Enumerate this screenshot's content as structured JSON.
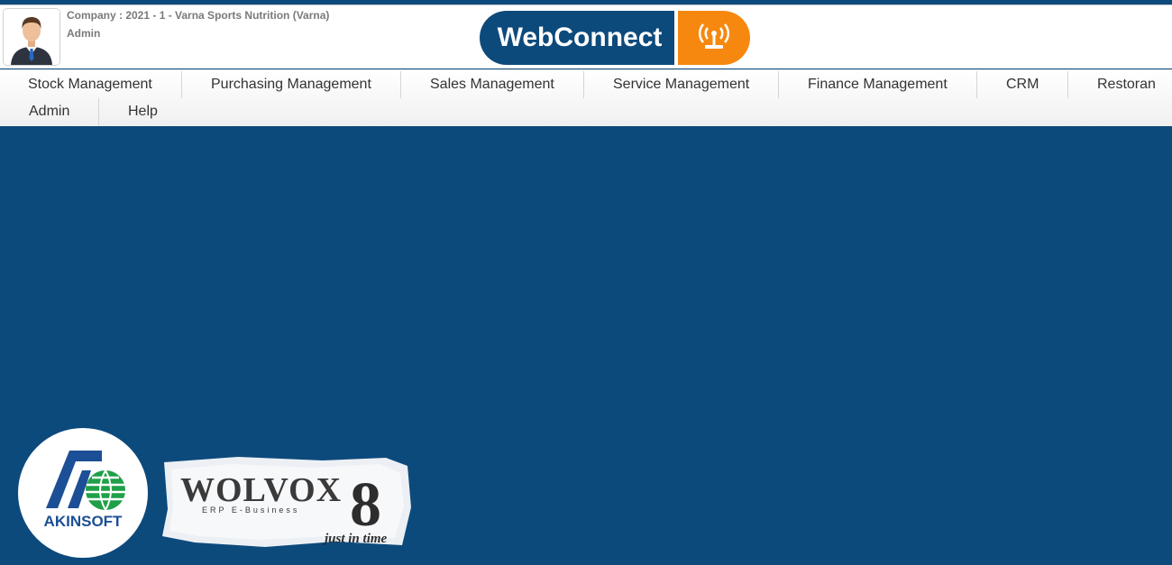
{
  "header": {
    "company_text": "Company : 2021 - 1 - Varna Sports Nutrition (Varna)",
    "user_name": "Admin",
    "avatar_icon": "user-avatar-icon"
  },
  "logo": {
    "text": "WebConnect",
    "icon": "antenna-signal-icon",
    "colors": {
      "blue": "#0d4a7c",
      "orange": "#f7880f"
    }
  },
  "nav": {
    "items": [
      {
        "label": "Stock Management"
      },
      {
        "label": "Purchasing Management"
      },
      {
        "label": "Sales Management"
      },
      {
        "label": "Service Management"
      },
      {
        "label": "Finance Management"
      },
      {
        "label": "CRM"
      },
      {
        "label": "Restoran"
      },
      {
        "label": "Admin"
      },
      {
        "label": "Help"
      }
    ]
  },
  "branding": {
    "akinsoft": "AKINSOFT",
    "wolvox": "WOLVOX",
    "wolvox_version": "8",
    "wolvox_sub": "ERP E-Business",
    "tagline": "just in time"
  },
  "colors": {
    "background": "#0d4a7c"
  }
}
